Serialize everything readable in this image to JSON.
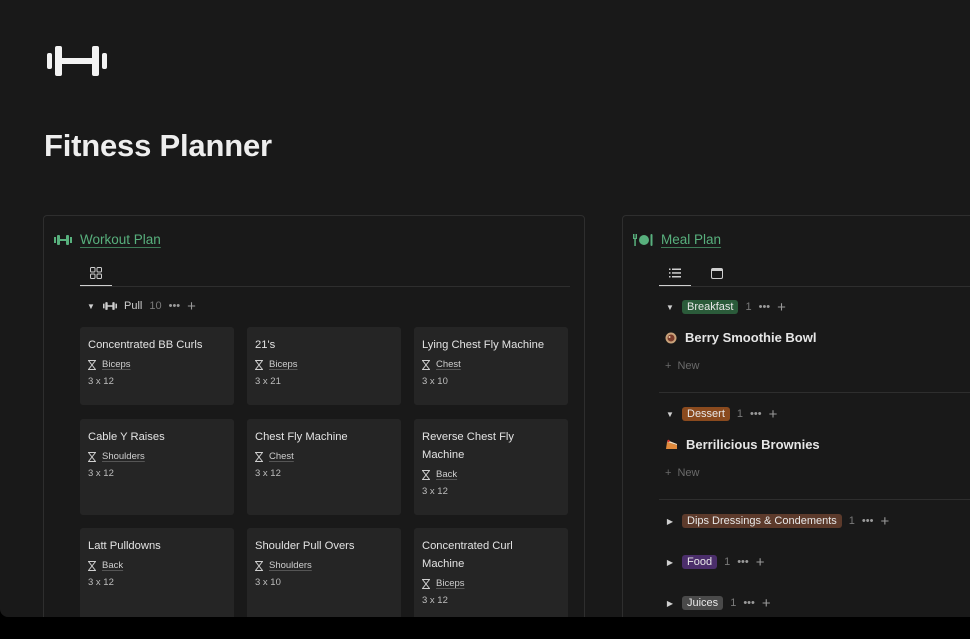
{
  "page": {
    "title": "Fitness Planner",
    "logo_icon": "dumbbell-icon"
  },
  "workout": {
    "title": "Workout Plan",
    "icon": "dumbbell-icon",
    "views": [
      {
        "icon": "gallery-icon",
        "active": true
      }
    ],
    "group": {
      "label": "Pull",
      "count": "10",
      "dots": "•••",
      "plus": "+"
    },
    "cards": [
      {
        "name": "Concentrated BB Curls",
        "tag": "Biceps",
        "sets": "3 x 12"
      },
      {
        "name": "21's",
        "tag": "Biceps",
        "sets": "3 x 21"
      },
      {
        "name": "Lying Chest Fly Machine",
        "tag": "Chest",
        "sets": "3 x 10"
      },
      {
        "name": "Cable Y Raises",
        "tag": "Shoulders",
        "sets": "3 x 12"
      },
      {
        "name": "Chest Fly Machine",
        "tag": "Chest",
        "sets": "3 x 12"
      },
      {
        "name": "Reverse Chest Fly Machine",
        "tag": "Back",
        "sets": "3 x 12"
      },
      {
        "name": "Latt Pulldowns",
        "tag": "Back",
        "sets": "3 x 12"
      },
      {
        "name": "Shoulder Pull Overs",
        "tag": "Shoulders",
        "sets": "3 x 10"
      },
      {
        "name": "Concentrated Curl Machine",
        "tag": "Biceps",
        "sets": "3 x 12"
      }
    ]
  },
  "meal": {
    "title": "Meal Plan",
    "icon": "fork-plate-icon",
    "views": [
      {
        "icon": "list-icon",
        "active": true
      },
      {
        "icon": "calendar-icon",
        "active": false
      }
    ],
    "new_label": "New",
    "groups": [
      {
        "label": "Breakfast",
        "count": "1",
        "expanded": true,
        "color": "#2b5b3a",
        "item": "Berry Smoothie Bowl",
        "item_icon": "smoothie-bowl-icon"
      },
      {
        "label": "Dessert",
        "count": "1",
        "expanded": true,
        "color": "#8a4a1e",
        "item": "Berrilicious Brownies",
        "item_icon": "cake-slice-icon"
      },
      {
        "label": "Dips Dressings & Condements",
        "count": "1",
        "expanded": false,
        "color": "#5c3a2b"
      },
      {
        "label": "Food",
        "count": "1",
        "expanded": false,
        "color": "#4b2e6b"
      },
      {
        "label": "Juices",
        "count": "1",
        "expanded": false,
        "color": "#4a4a4a"
      }
    ],
    "dots": "•••",
    "plus": "+"
  }
}
